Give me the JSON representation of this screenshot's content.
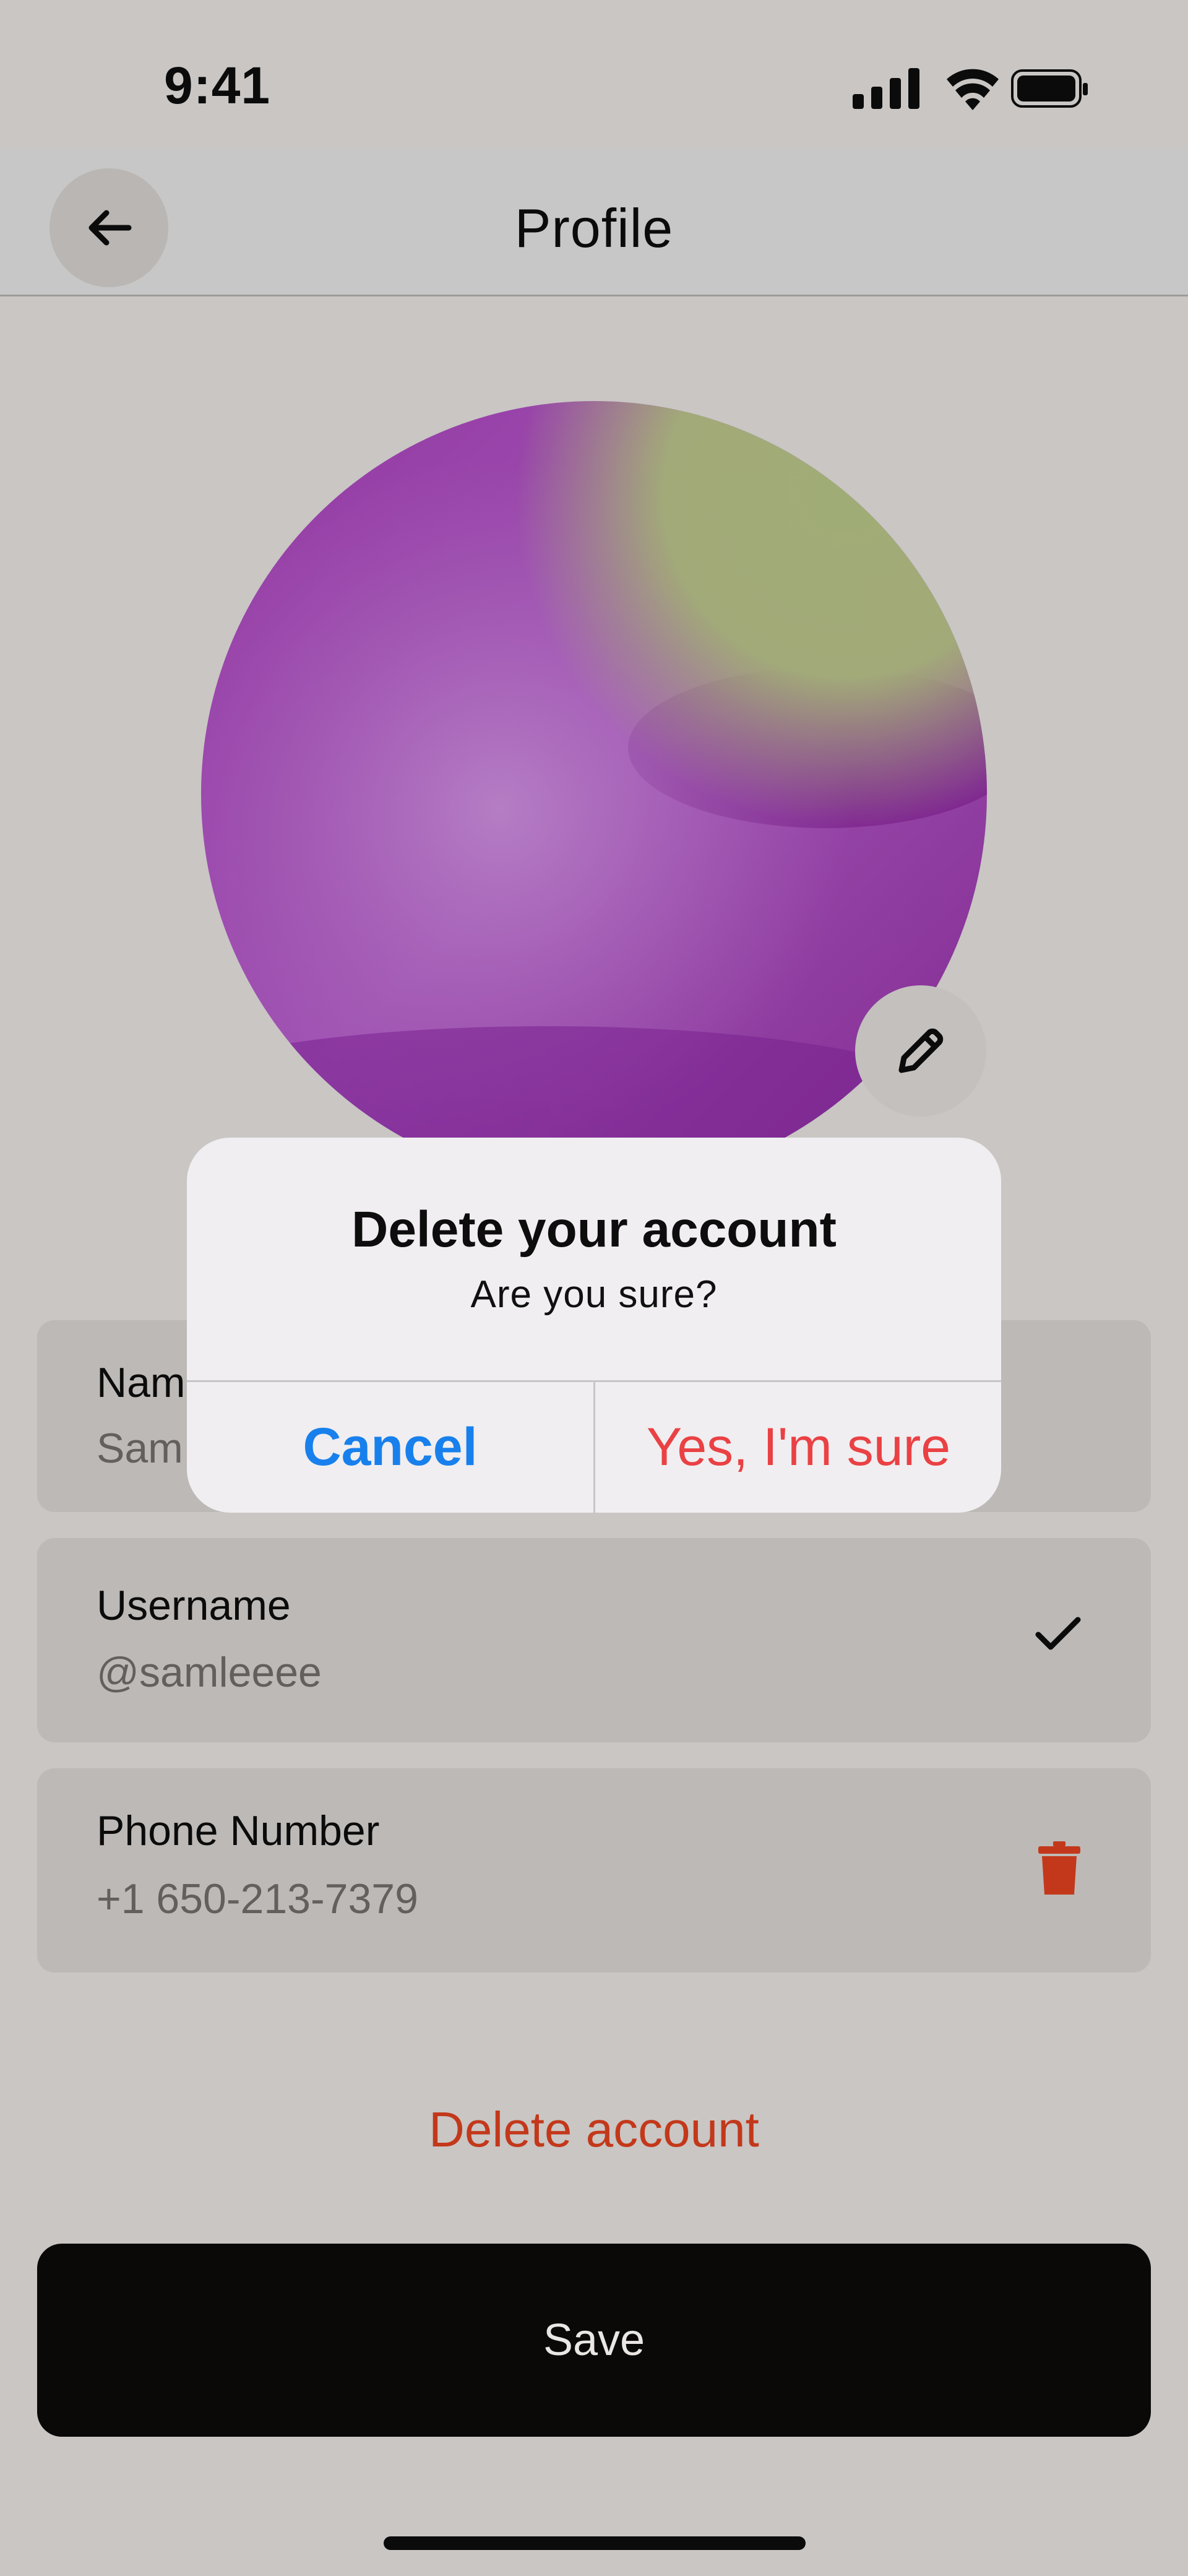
{
  "status_bar": {
    "time": "9:41"
  },
  "header": {
    "title": "Profile",
    "back_icon": "arrow-left-icon"
  },
  "avatar": {
    "edit_icon": "pencil-icon",
    "colors": [
      "#7a1e8a",
      "#a35ab5",
      "#9ba86f"
    ]
  },
  "fields": {
    "name": {
      "label": "Name",
      "value": "Sam"
    },
    "username": {
      "label": "Username",
      "value": "@samleeee",
      "icon": "check-icon"
    },
    "phone": {
      "label": "Phone Number",
      "value": "+1 650-213-7379",
      "icon": "trash-icon"
    }
  },
  "actions": {
    "delete_label": "Delete account",
    "save_label": "Save"
  },
  "dialog": {
    "title": "Delete your account",
    "message": "Are you sure?",
    "cancel_label": "Cancel",
    "confirm_label": "Yes, I'm sure"
  },
  "colors": {
    "accent_blue": "#1880ec",
    "danger": "#c3381a",
    "confirm_red": "#ea4144"
  }
}
